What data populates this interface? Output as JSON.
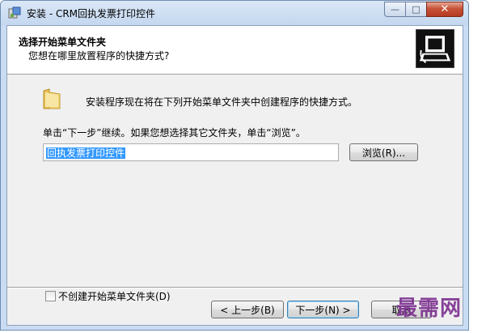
{
  "window": {
    "title": "安装 - CRM回执发票打印控件",
    "caption": {
      "minimize": "—",
      "maximize": "□",
      "close": "✕"
    }
  },
  "header": {
    "title": "选择开始菜单文件夹",
    "subtitle": "您想在哪里放置程序的快捷方式?"
  },
  "body": {
    "intro": "安装程序现在将在下列开始菜单文件夹中创建程序的快捷方式。",
    "instruction": "单击“下一步”继续。如果您想选择其它文件夹，单击“浏览”。",
    "folder_value": "回执发票打印控件",
    "browse_label": "浏览(R)...",
    "no_folder_checkbox_label": "不创建开始菜单文件夹(D)"
  },
  "footer": {
    "back_label": "< 上一步(B)",
    "next_label": "下一步(N) >",
    "cancel_label": "取消"
  },
  "watermark": "最需网",
  "icons": {
    "app": "installer-icon",
    "header": "computer-setup-icon",
    "folder": "folder-icon"
  }
}
